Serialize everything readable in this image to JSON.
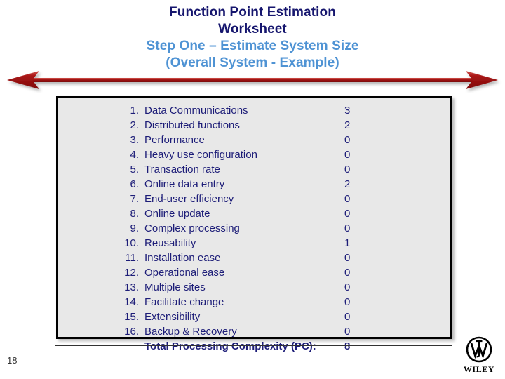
{
  "slide": {
    "title_lines": [
      {
        "text": "Function Point Estimation",
        "tone": "dark"
      },
      {
        "text": "Worksheet",
        "tone": "dark"
      },
      {
        "text": "Step One – Estimate System Size",
        "tone": "blue"
      },
      {
        "text": "(Overall System - Example)",
        "tone": "blue"
      }
    ],
    "colors": {
      "title_dark": "#16166e",
      "title_blue": "#4f93d4",
      "arrow_red": "#a81414",
      "box_fill": "#e8e8e8",
      "box_border": "#000000",
      "list_text": "#1d1d78"
    }
  },
  "arrow": {
    "name": "double-headed-arrow",
    "direction": "both"
  },
  "worksheet": {
    "factors": [
      {
        "num": "1.",
        "label": "Data Communications",
        "value": "3"
      },
      {
        "num": "2.",
        "label": "Distributed functions",
        "value": "2"
      },
      {
        "num": "3.",
        "label": "Performance",
        "value": "0"
      },
      {
        "num": "4.",
        "label": "Heavy use configuration",
        "value": "0"
      },
      {
        "num": "5.",
        "label": "Transaction rate",
        "value": "0"
      },
      {
        "num": "6.",
        "label": "Online data entry",
        "value": "2"
      },
      {
        "num": "7.",
        "label": "End-user efficiency",
        "value": "0"
      },
      {
        "num": "8.",
        "label": "Online update",
        "value": "0"
      },
      {
        "num": "9.",
        "label": "Complex processing",
        "value": "0"
      },
      {
        "num": "10.",
        "label": "Reusability",
        "value": "1"
      },
      {
        "num": "11.",
        "label": "Installation ease",
        "value": "0"
      },
      {
        "num": "12.",
        "label": "Operational ease",
        "value": "0"
      },
      {
        "num": "13.",
        "label": "Multiple sites",
        "value": "0"
      },
      {
        "num": "14.",
        "label": "Facilitate change",
        "value": "0"
      },
      {
        "num": "15.",
        "label": "Extensibility",
        "value": "0"
      },
      {
        "num": "16.",
        "label": "Backup & Recovery",
        "value": "0"
      }
    ],
    "total": {
      "num": "",
      "label": "Total Processing Complexity (PC):",
      "value": "8"
    }
  },
  "footer": {
    "page_number": "18",
    "logo_wordmark": "WILEY"
  }
}
